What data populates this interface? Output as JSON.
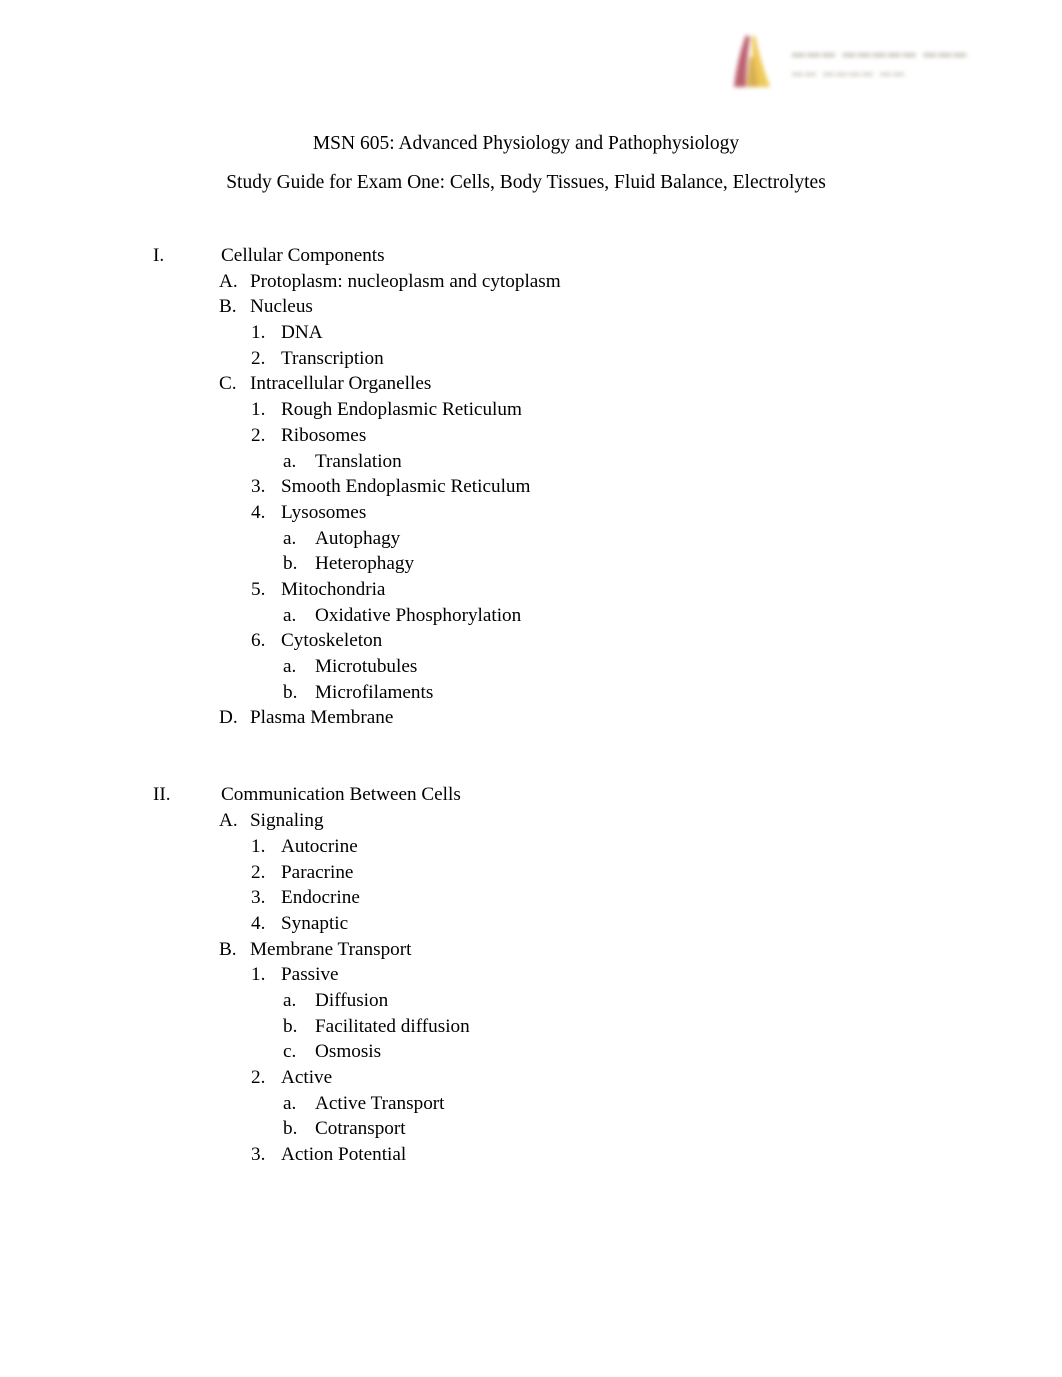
{
  "page": {
    "background_color": "#ffffff",
    "text_color": "#000000"
  },
  "logo": {
    "name": "university-logo",
    "mark_colors": {
      "crimson": "#a32638",
      "gold": "#e8b419",
      "dark_gold": "#c98f12"
    },
    "wordmark_line_1": "",
    "wordmark_line_2": "",
    "appearance": "faded-blurred"
  },
  "titles": {
    "line_1": "MSN 605: Advanced Physiology and Pathophysiology",
    "line_2": "Study Guide for Exam One: Cells, Body Tissues, Fluid Balance, Electrolytes"
  },
  "outline": [
    {
      "level": 1,
      "marker": "I.",
      "text": "Cellular Components"
    },
    {
      "level": 2,
      "marker": "A.",
      "text": "Protoplasm: nucleoplasm and cytoplasm"
    },
    {
      "level": 2,
      "marker": "B.",
      "text": "Nucleus"
    },
    {
      "level": 3,
      "marker": "1.",
      "text": "DNA"
    },
    {
      "level": 3,
      "marker": "2.",
      "text": "Transcription"
    },
    {
      "level": 2,
      "marker": "C.",
      "text": "Intracellular Organelles"
    },
    {
      "level": 3,
      "marker": "1.",
      "text": "Rough Endoplasmic Reticulum"
    },
    {
      "level": 3,
      "marker": "2.",
      "text": "Ribosomes"
    },
    {
      "level": 4,
      "marker": "a.",
      "text": "Translation"
    },
    {
      "level": 3,
      "marker": "3.",
      "text": "Smooth Endoplasmic Reticulum"
    },
    {
      "level": 3,
      "marker": "4.",
      "text": "Lysosomes"
    },
    {
      "level": 4,
      "marker": "a.",
      "text": "Autophagy"
    },
    {
      "level": 4,
      "marker": "b.",
      "text": "Heterophagy"
    },
    {
      "level": 3,
      "marker": "5.",
      "text": "Mitochondria"
    },
    {
      "level": 4,
      "marker": "a.",
      "text": "Oxidative Phosphorylation"
    },
    {
      "level": 3,
      "marker": "6.",
      "text": "Cytoskeleton"
    },
    {
      "level": 4,
      "marker": "a.",
      "text": "Microtubules"
    },
    {
      "level": 4,
      "marker": "b.",
      "text": "Microfilaments"
    },
    {
      "level": 2,
      "marker": "D.",
      "text": "Plasma Membrane"
    },
    {
      "level": 0,
      "marker": "",
      "text": ""
    },
    {
      "level": 0,
      "marker": "",
      "text": ""
    },
    {
      "level": 1,
      "marker": "II.",
      "text": "Communication Between Cells"
    },
    {
      "level": 2,
      "marker": "A.",
      "text": "Signaling"
    },
    {
      "level": 3,
      "marker": "1.",
      "text": "Autocrine"
    },
    {
      "level": 3,
      "marker": "2.",
      "text": "Paracrine"
    },
    {
      "level": 3,
      "marker": "3.",
      "text": "Endocrine"
    },
    {
      "level": 3,
      "marker": "4.",
      "text": "Synaptic"
    },
    {
      "level": 2,
      "marker": "B.",
      "text": "Membrane Transport"
    },
    {
      "level": 3,
      "marker": "1.",
      "text": "Passive"
    },
    {
      "level": 4,
      "marker": "a.",
      "text": "Diffusion"
    },
    {
      "level": 4,
      "marker": "b.",
      "text": "Facilitated diffusion"
    },
    {
      "level": 4,
      "marker": "c.",
      "text": "Osmosis"
    },
    {
      "level": 3,
      "marker": "2.",
      "text": "Active"
    },
    {
      "level": 4,
      "marker": "a.",
      "text": "Active Transport"
    },
    {
      "level": 4,
      "marker": "b.",
      "text": "Cotransport"
    },
    {
      "level": 3,
      "marker": "3.",
      "text": "Action Potential"
    }
  ]
}
